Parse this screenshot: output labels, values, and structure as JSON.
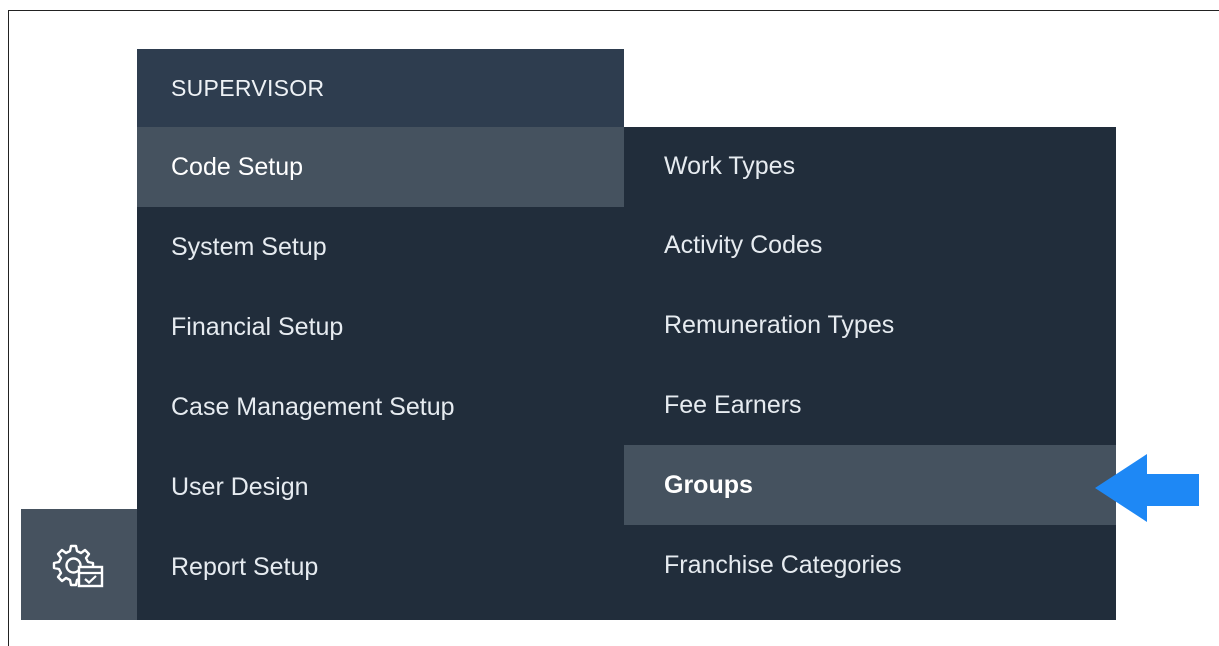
{
  "supervisor_menu": {
    "header": "SUPERVISOR",
    "items": [
      {
        "label": "Code Setup",
        "active": true
      },
      {
        "label": "System Setup",
        "active": false
      },
      {
        "label": "Financial Setup",
        "active": false
      },
      {
        "label": "Case Management Setup",
        "active": false
      },
      {
        "label": "User Design",
        "active": false
      },
      {
        "label": "Report Setup",
        "active": false
      }
    ]
  },
  "code_setup_submenu": {
    "items": [
      {
        "label": "Work Types",
        "active": false
      },
      {
        "label": "Activity Codes",
        "active": false
      },
      {
        "label": "Remuneration Types",
        "active": false
      },
      {
        "label": "Fee Earners",
        "active": false
      },
      {
        "label": "Groups",
        "active": true
      },
      {
        "label": "Franchise Categories",
        "active": false
      }
    ]
  },
  "rail": {
    "icon": "settings-calendar-icon"
  },
  "colors": {
    "menu_bg": "#212d3b",
    "header_bg": "#2e3d4f",
    "active_bg": "#45525f",
    "callout_arrow": "#1e88f5"
  },
  "annotation": {
    "icon": "left-arrow-icon"
  }
}
